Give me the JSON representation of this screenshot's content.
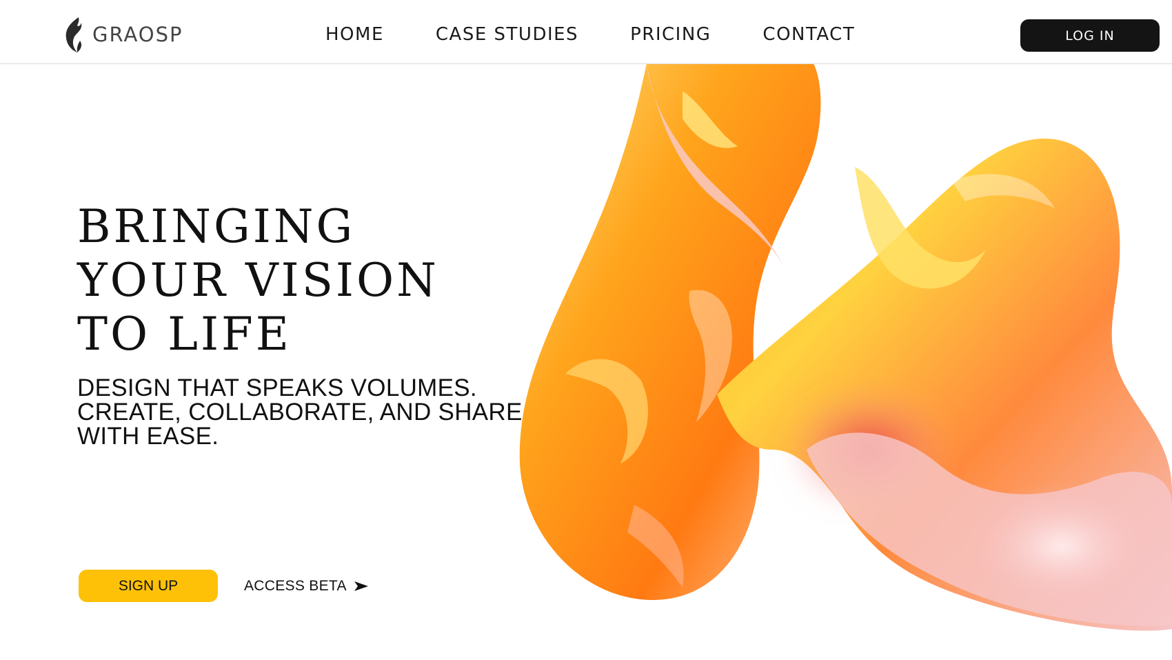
{
  "brand": {
    "name": "GRAOSP",
    "logo_icon": "flame-leaf-icon"
  },
  "nav": {
    "items": [
      {
        "label": "HOME"
      },
      {
        "label": "CASE STUDIES"
      },
      {
        "label": "PRICING"
      },
      {
        "label": "CONTACT"
      }
    ]
  },
  "header": {
    "login_label": "LOG IN"
  },
  "hero": {
    "headline_lines": [
      "BRINGING",
      "YOUR VISION",
      "TO LIFE"
    ],
    "subhead_lines": [
      "DESIGN THAT SPEAKS VOLUMES.",
      "CREATE, COLLABORATE, AND SHARE",
      "WITH EASE."
    ],
    "signup_label": "SIGN UP",
    "access_label": "ACCESS BETA",
    "access_icon": "arrow-right-icon",
    "art_icon": "abstract-fluid-art"
  },
  "colors": {
    "accent": "#ffc107",
    "login_bg": "#141414",
    "art_orange": "#ff8c1a",
    "art_yellow": "#ffd23f",
    "art_pink": "#f7b8b8",
    "art_red": "#e8323a"
  }
}
